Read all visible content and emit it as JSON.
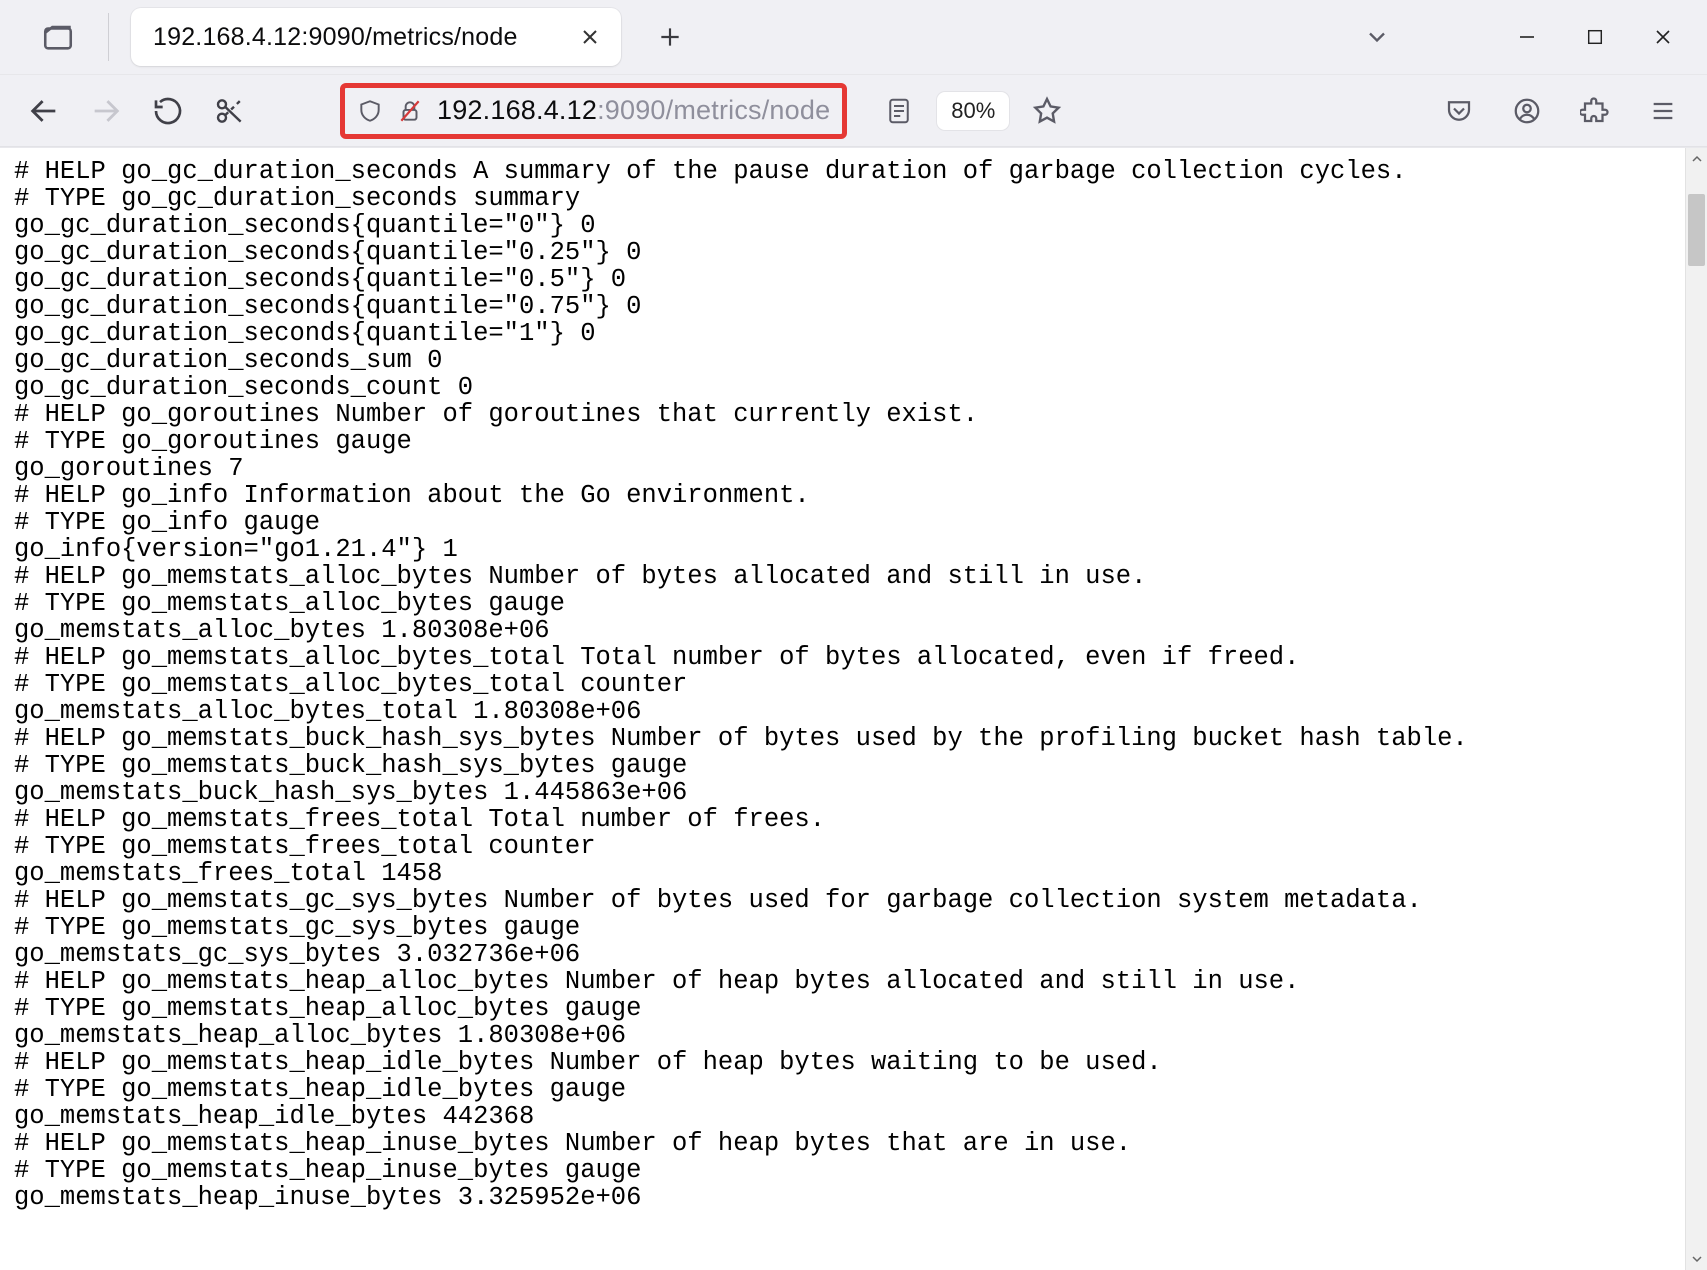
{
  "tab": {
    "title": "192.168.4.12:9090/metrics/node"
  },
  "url": {
    "host": "192.168.4.12",
    "port_path": ":9090/metrics/node"
  },
  "zoom": "80%",
  "metrics_text": "# HELP go_gc_duration_seconds A summary of the pause duration of garbage collection cycles.\n# TYPE go_gc_duration_seconds summary\ngo_gc_duration_seconds{quantile=\"0\"} 0\ngo_gc_duration_seconds{quantile=\"0.25\"} 0\ngo_gc_duration_seconds{quantile=\"0.5\"} 0\ngo_gc_duration_seconds{quantile=\"0.75\"} 0\ngo_gc_duration_seconds{quantile=\"1\"} 0\ngo_gc_duration_seconds_sum 0\ngo_gc_duration_seconds_count 0\n# HELP go_goroutines Number of goroutines that currently exist.\n# TYPE go_goroutines gauge\ngo_goroutines 7\n# HELP go_info Information about the Go environment.\n# TYPE go_info gauge\ngo_info{version=\"go1.21.4\"} 1\n# HELP go_memstats_alloc_bytes Number of bytes allocated and still in use.\n# TYPE go_memstats_alloc_bytes gauge\ngo_memstats_alloc_bytes 1.80308e+06\n# HELP go_memstats_alloc_bytes_total Total number of bytes allocated, even if freed.\n# TYPE go_memstats_alloc_bytes_total counter\ngo_memstats_alloc_bytes_total 1.80308e+06\n# HELP go_memstats_buck_hash_sys_bytes Number of bytes used by the profiling bucket hash table.\n# TYPE go_memstats_buck_hash_sys_bytes gauge\ngo_memstats_buck_hash_sys_bytes 1.445863e+06\n# HELP go_memstats_frees_total Total number of frees.\n# TYPE go_memstats_frees_total counter\ngo_memstats_frees_total 1458\n# HELP go_memstats_gc_sys_bytes Number of bytes used for garbage collection system metadata.\n# TYPE go_memstats_gc_sys_bytes gauge\ngo_memstats_gc_sys_bytes 3.032736e+06\n# HELP go_memstats_heap_alloc_bytes Number of heap bytes allocated and still in use.\n# TYPE go_memstats_heap_alloc_bytes gauge\ngo_memstats_heap_alloc_bytes 1.80308e+06\n# HELP go_memstats_heap_idle_bytes Number of heap bytes waiting to be used.\n# TYPE go_memstats_heap_idle_bytes gauge\ngo_memstats_heap_idle_bytes 442368\n# HELP go_memstats_heap_inuse_bytes Number of heap bytes that are in use.\n# TYPE go_memstats_heap_inuse_bytes gauge\ngo_memstats_heap_inuse_bytes 3.325952e+06"
}
